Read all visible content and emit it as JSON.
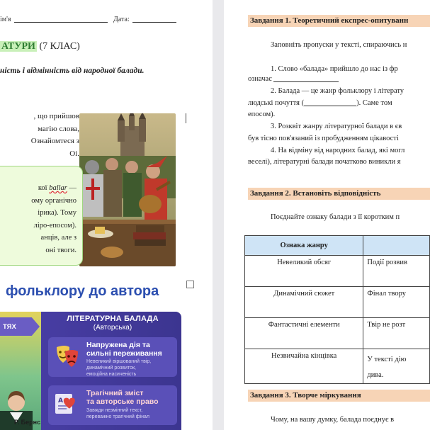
{
  "left_page": {
    "name_label": "ім'я",
    "date_label": "Дата:",
    "title_highlight": "АТУРИ",
    "title_rest": " (7 КЛАС)",
    "subtitle": "ність і відмінність від народної балади.",
    "intro_lines": [
      ", що прийшов",
      "магію слова,",
      "Ознайомтеся з"
    ],
    "intro_last": "Оі.",
    "green_box_lines": [
      "кої ",
      "ому органічно",
      "ірика). Тому",
      "ліро-епосом).",
      "анців, але з",
      "оні твоги."
    ],
    "green_box_word": "ballar",
    "green_box_word_tail": " —",
    "section_heading": "фольклору до автора",
    "infographic": {
      "left_tab": "ТЯХ",
      "column_title": "ЛІТЕРАТУРНА БАЛАДА",
      "column_subtitle": "(Авторська)",
      "cards": [
        {
          "title_lines": [
            "Напружена дія та",
            "сильні переживання"
          ],
          "desc_lines": [
            "Невеликий віршований твір,",
            "динамічний розвиток,",
            "емоційна насиченість"
          ],
          "icon": "theater-masks-icon"
        },
        {
          "title_lines": [
            "Трагічний зміст",
            "та авторське право"
          ],
          "desc_lines": [
            "Завжди незмінний текст,",
            "переважно трагічний фінал"
          ],
          "icon": "book-heart-icon"
        }
      ],
      "portrait_caption": "Р. Бернс"
    }
  },
  "right_page": {
    "task1": {
      "heading": "Завдання 1. Теоретичний експрес-опитуванн",
      "instruction": "Заповніть пропуски у тексті, спираючись н",
      "items": [
        [
          "1. Слово «балада» прийшло до нас із фр",
          "означає"
        ],
        [
          "2. Балада — це жанр фольклору і літерату",
          "людські почуття (",
          "). Саме том",
          "епосом)."
        ],
        [
          "3. Розквіт жанру літературної балади в єв",
          "був тісно пов'язаний із пробудженням цікавості"
        ],
        [
          "4. На відміну від народних балад, які могл",
          "веселі), літературні балади початково виникли я"
        ]
      ]
    },
    "task2": {
      "heading": "Завдання 2. Встановіть відповідність",
      "instruction": "Поєднайте ознаку балади з її коротким п",
      "table": {
        "headers": [
          "Ознака жанру",
          ""
        ],
        "rows": [
          [
            "Невеликий обсяг",
            "Події розвив"
          ],
          [
            "Динамічний сюжет",
            "Фінал твору"
          ],
          [
            "Фантастичні елементи",
            "Твір не розт"
          ],
          [
            "Незвичайна кінцівка",
            "У тексті дію"
          ]
        ],
        "overflow_text": "дива."
      }
    },
    "task3": {
      "heading": "Завдання 3. Творче міркування",
      "text": "Чому, на вашу думку, балада поєднує в"
    }
  }
}
